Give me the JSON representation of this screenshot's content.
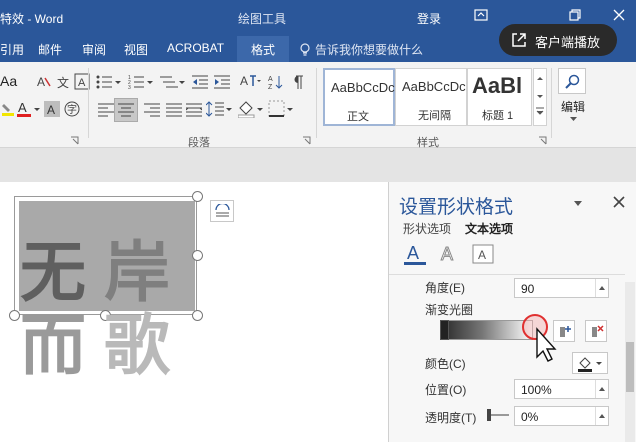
{
  "titlebar": {
    "title": "特效 - Word",
    "context_tools": "绘图工具",
    "login": "登录"
  },
  "tabs": {
    "references": "引用",
    "mailings": "邮件",
    "review": "审阅",
    "view": "视图",
    "acrobat": "ACROBAT",
    "format": "格式",
    "tell_me": "告诉我你想要做什么"
  },
  "screencast": {
    "label": "客户端播放"
  },
  "ribbon": {
    "font_aa": "Aa",
    "paragraph_group": "段落",
    "styles_group": "样式",
    "styles": [
      {
        "sample": "AaBbCcDc",
        "name": "正文"
      },
      {
        "sample": "AaBbCcDc",
        "name": "无间隔"
      },
      {
        "sample": "AaBl",
        "name": "标题 1"
      }
    ],
    "edit_label": "编辑"
  },
  "document": {
    "line1": [
      "无",
      "岸"
    ],
    "line2": [
      "而",
      "歌"
    ]
  },
  "pane": {
    "title": "设置形状格式",
    "tab_shape": "形状选项",
    "tab_text": "文本选项",
    "angle_label": "角度(E)",
    "angle_value": "90",
    "gradient_stops_label": "渐变光圈",
    "color_label": "颜色(C)",
    "position_label": "位置(O)",
    "position_value": "100%",
    "transparency_label": "透明度(T)",
    "transparency_value": "0%"
  },
  "colors": {
    "word_blue": "#2b579a",
    "pane_title": "#2b579a",
    "gradient_marker": "#e03030"
  }
}
